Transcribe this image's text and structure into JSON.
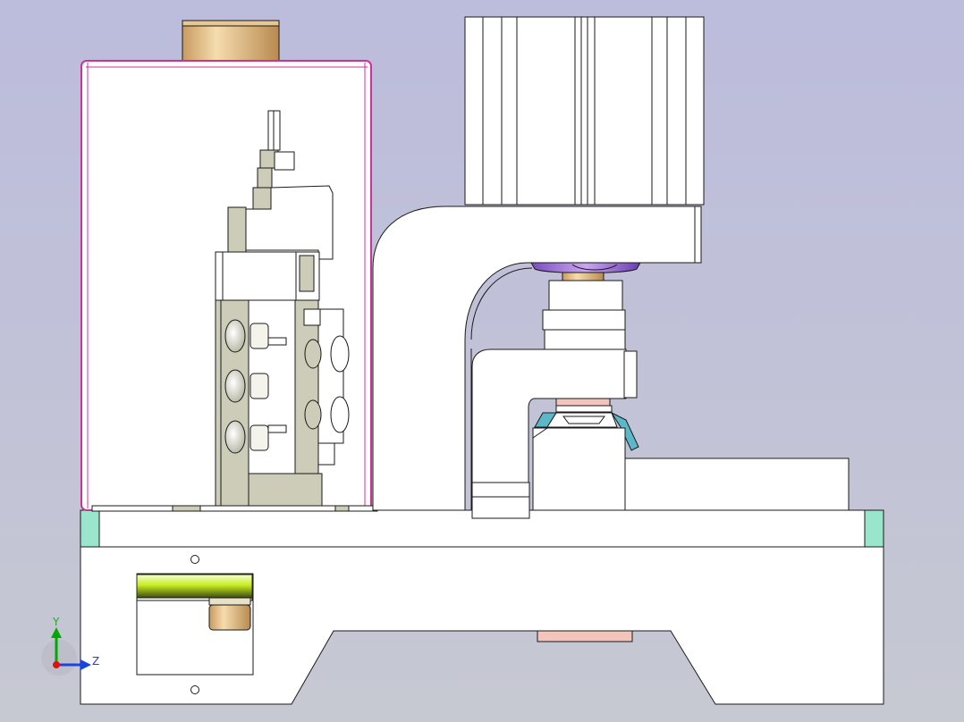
{
  "viewport": {
    "background_top": "#bcbcdc",
    "background_bottom": "#c6c8d2"
  },
  "colors": {
    "part_fill": "#ffffff",
    "edge": "#1a1a1a",
    "gray_body": "#ccccb8",
    "cabinet_edge": "#cc3399",
    "cyan_block": "#99e6cc",
    "purple_disc": "#9966cc",
    "copper": "#e8b070",
    "teal_fixture": "#5ab8c8",
    "salmon": "#f3c4bc"
  },
  "triad": {
    "y_label": "Y",
    "z_label": "Z"
  }
}
